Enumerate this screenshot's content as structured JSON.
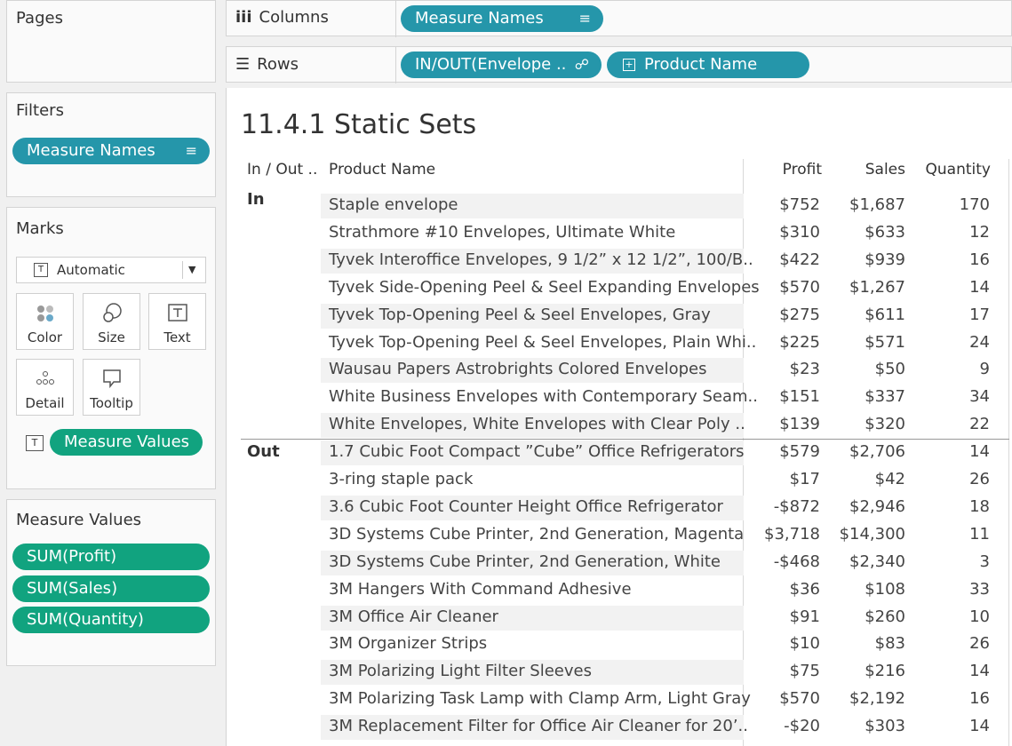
{
  "pages": {
    "title": "Pages"
  },
  "filters": {
    "title": "Filters",
    "pill": "Measure Names"
  },
  "marks": {
    "title": "Marks",
    "dropdown_value": "Automatic",
    "buttons": [
      "Color",
      "Size",
      "Text",
      "Detail",
      "Tooltip"
    ],
    "pill": "Measure Values"
  },
  "measure_values": {
    "title": "Measure Values",
    "pills": [
      "SUM(Profit)",
      "SUM(Sales)",
      "SUM(Quantity)"
    ]
  },
  "shelves": {
    "columns_label": "Columns",
    "columns_pill": "Measure Names",
    "rows_label": "Rows",
    "rows_pills": [
      "IN/OUT(Envelope ..",
      "Product Name"
    ]
  },
  "viz": {
    "title": "11.4.1 Static Sets",
    "headers": [
      "In / Out ..",
      "Product Name",
      "Profit",
      "Sales",
      "Quantity"
    ],
    "groups": [
      {
        "label": "In",
        "rows": [
          [
            "Staple envelope",
            "$752",
            "$1,687",
            "170"
          ],
          [
            "Strathmore #10 Envelopes, Ultimate White",
            "$310",
            "$633",
            "12"
          ],
          [
            "Tyvek Interoffice Envelopes, 9 1/2” x 12 1/2”, 100/B..",
            "$422",
            "$939",
            "16"
          ],
          [
            "Tyvek Side-Opening Peel & Seel Expanding Envelopes",
            "$570",
            "$1,267",
            "14"
          ],
          [
            "Tyvek  Top-Opening Peel & Seel  Envelopes, Gray",
            "$275",
            "$611",
            "17"
          ],
          [
            "Tyvek  Top-Opening Peel & Seel Envelopes, Plain Whi..",
            "$225",
            "$571",
            "24"
          ],
          [
            "Wausau Papers Astrobrights Colored Envelopes",
            "$23",
            "$50",
            "9"
          ],
          [
            "White Business Envelopes with Contemporary Seam..",
            "$151",
            "$337",
            "34"
          ],
          [
            "White Envelopes, White Envelopes with Clear Poly ..",
            "$139",
            "$320",
            "22"
          ]
        ]
      },
      {
        "label": "Out",
        "rows": [
          [
            "1.7 Cubic Foot Compact ”Cube” Office Refrigerators",
            "$579",
            "$2,706",
            "14"
          ],
          [
            "3-ring staple pack",
            "$17",
            "$42",
            "26"
          ],
          [
            "3.6 Cubic Foot Counter Height Office Refrigerator",
            "-$872",
            "$2,946",
            "18"
          ],
          [
            "3D Systems Cube Printer, 2nd Generation, Magenta",
            "$3,718",
            "$14,300",
            "11"
          ],
          [
            "3D Systems Cube Printer, 2nd Generation, White",
            "-$468",
            "$2,340",
            "3"
          ],
          [
            "3M Hangers With Command Adhesive",
            "$36",
            "$108",
            "33"
          ],
          [
            "3M Office Air Cleaner",
            "$91",
            "$260",
            "10"
          ],
          [
            "3M Organizer Strips",
            "$10",
            "$83",
            "26"
          ],
          [
            "3M Polarizing Light Filter Sleeves",
            "$75",
            "$216",
            "14"
          ],
          [
            "3M Polarizing Task Lamp with Clamp Arm, Light Gray",
            "$570",
            "$2,192",
            "16"
          ],
          [
            "3M Replacement Filter for Office Air Cleaner for 20’..",
            "-$20",
            "$303",
            "14"
          ]
        ]
      }
    ]
  }
}
